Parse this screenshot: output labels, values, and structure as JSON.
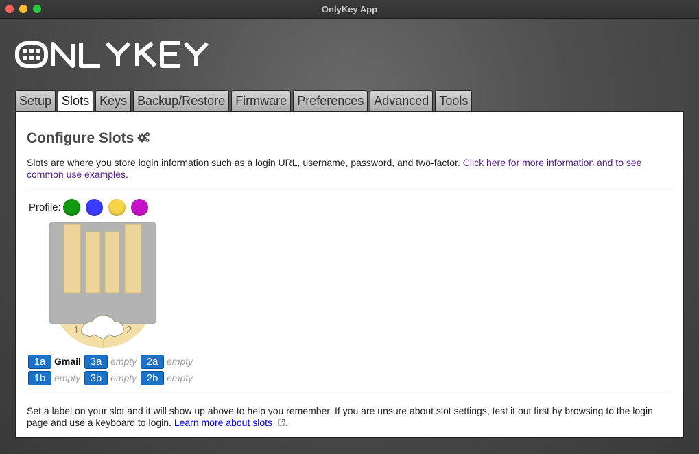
{
  "window": {
    "title": "OnlyKey App"
  },
  "logo_text": "ONLYKEY",
  "tabs": [
    {
      "label": "Setup"
    },
    {
      "label": "Slots"
    },
    {
      "label": "Keys"
    },
    {
      "label": "Backup/Restore"
    },
    {
      "label": "Firmware"
    },
    {
      "label": "Preferences"
    },
    {
      "label": "Advanced"
    },
    {
      "label": "Tools"
    }
  ],
  "active_tab": "Slots",
  "main": {
    "heading": "Configure Slots",
    "intro_text": "Slots are where you store login information such as a login URL, username, password, and two-factor. ",
    "intro_link": "Click here for more information and to see common use examples",
    "intro_end": ".",
    "profile_label": "Profile:",
    "profiles": [
      {
        "color": "#119a11"
      },
      {
        "color": "#3b3bff"
      },
      {
        "color": "#f5d44a"
      },
      {
        "color": "#c711c7"
      }
    ],
    "key_labels": {
      "left": "1",
      "right": "2"
    },
    "slots": {
      "row_a": [
        {
          "id": "1a",
          "label": "Gmail",
          "state": "filled"
        },
        {
          "id": "3a",
          "label": "empty",
          "state": "empty"
        },
        {
          "id": "2a",
          "label": "empty",
          "state": "empty"
        }
      ],
      "row_b": [
        {
          "id": "1b",
          "label": "empty",
          "state": "empty"
        },
        {
          "id": "3b",
          "label": "empty",
          "state": "empty"
        },
        {
          "id": "2b",
          "label": "empty",
          "state": "empty"
        }
      ]
    },
    "footer_text": "Set a label on your slot and it will show up above to help you remember. If you are unsure about slot settings, test it out first by browsing to the login page and use a keyboard to login. ",
    "footer_link": "Learn more about slots",
    "footer_end": "."
  }
}
